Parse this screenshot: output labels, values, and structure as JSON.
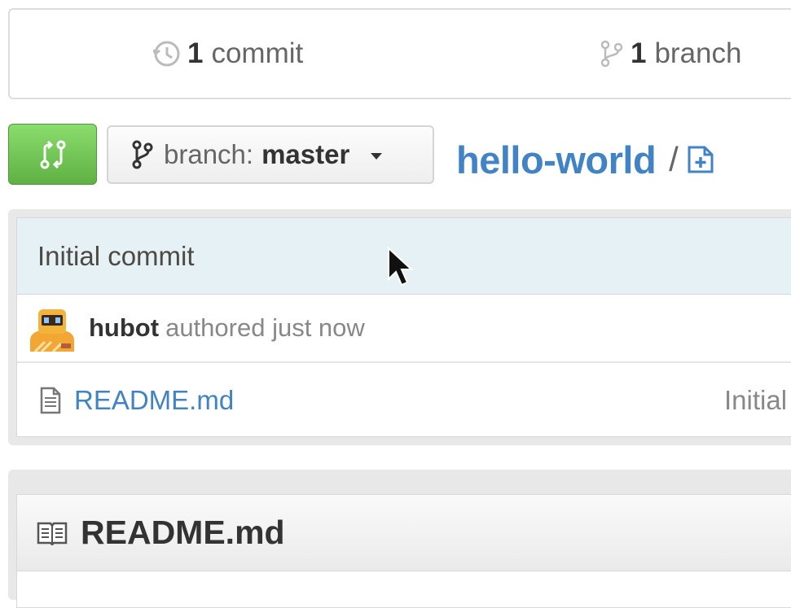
{
  "stats": {
    "commits": {
      "count": "1",
      "label": "commit",
      "icon": "history-icon"
    },
    "branches": {
      "count": "1",
      "label": "branch",
      "icon": "git-branch-icon"
    }
  },
  "file_navigation": {
    "compare_button": {
      "icon": "git-compare-icon",
      "color": "#6cc644"
    },
    "branch_selector": {
      "prefix": "branch:",
      "value": "master",
      "icon": "git-branch-icon"
    },
    "breadcrumb": {
      "repo": "hello-world",
      "separator": "/",
      "add_file_icon": "file-add-icon"
    }
  },
  "latest_commit": {
    "message": "Initial commit",
    "author": "hubot",
    "authored": "authored just now",
    "avatar": "hubot-avatar"
  },
  "files": [
    {
      "name": "README.md",
      "commit_message": "Initial",
      "icon": "file-text-icon"
    }
  ],
  "readme": {
    "title": "README.md",
    "icon": "book-icon"
  },
  "colors": {
    "link": "#4183c4",
    "commit_title_bg": "#e6f1f6",
    "compare_green": "#6cc644"
  }
}
